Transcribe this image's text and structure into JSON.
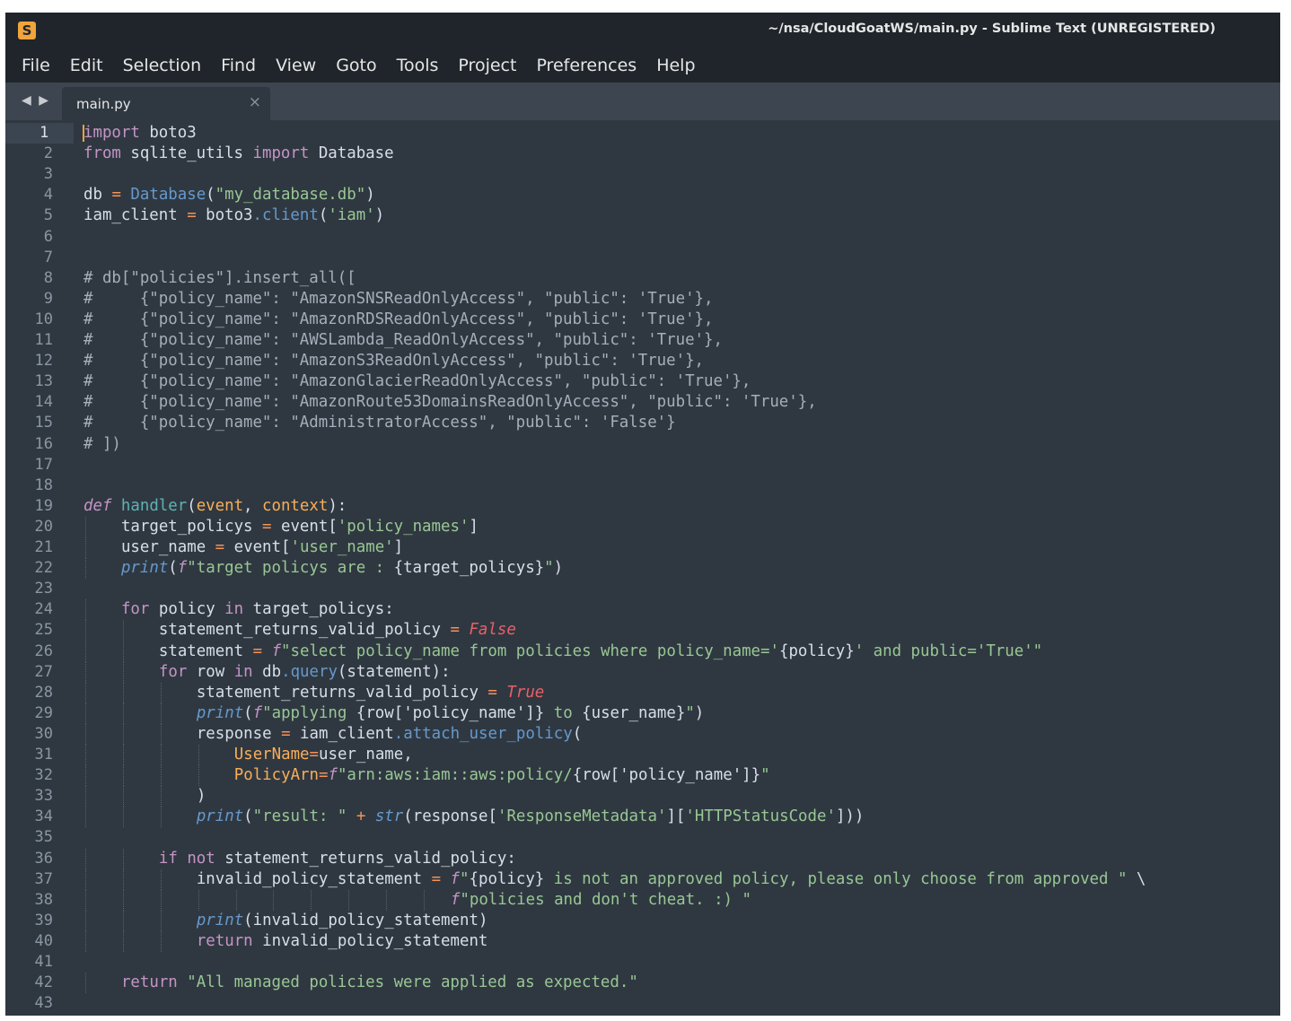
{
  "window": {
    "title": "~/nsa/CloudGoatWS/main.py - Sublime Text (UNREGISTERED)",
    "app_icon_glyph": "S"
  },
  "menubar": {
    "items": [
      "File",
      "Edit",
      "Selection",
      "Find",
      "View",
      "Goto",
      "Tools",
      "Project",
      "Preferences",
      "Help"
    ]
  },
  "tabs": [
    {
      "label": "main.py",
      "close_glyph": "×",
      "active": true
    }
  ],
  "tab_nav_glyph": "◀ ▶",
  "editor": {
    "active_line": 1,
    "line_numbers": [
      "1",
      "2",
      "3",
      "4",
      "5",
      "6",
      "7",
      "8",
      "9",
      "10",
      "11",
      "12",
      "13",
      "14",
      "15",
      "16",
      "17",
      "18",
      "19",
      "20",
      "21",
      "22",
      "23",
      "24",
      "25",
      "26",
      "27",
      "28",
      "29",
      "30",
      "31",
      "32",
      "33",
      "34",
      "35",
      "36",
      "37",
      "38",
      "39",
      "40",
      "41",
      "42",
      "43"
    ],
    "code_lines": [
      "import boto3",
      "from sqlite_utils import Database",
      "",
      "db = Database(\"my_database.db\")",
      "iam_client = boto3.client('iam')",
      "",
      "",
      "# db[\"policies\"].insert_all([",
      "#     {\"policy_name\": \"AmazonSNSReadOnlyAccess\", \"public\": 'True'},",
      "#     {\"policy_name\": \"AmazonRDSReadOnlyAccess\", \"public\": 'True'},",
      "#     {\"policy_name\": \"AWSLambda_ReadOnlyAccess\", \"public\": 'True'},",
      "#     {\"policy_name\": \"AmazonS3ReadOnlyAccess\", \"public\": 'True'},",
      "#     {\"policy_name\": \"AmazonGlacierReadOnlyAccess\", \"public\": 'True'},",
      "#     {\"policy_name\": \"AmazonRoute53DomainsReadOnlyAccess\", \"public\": 'True'},",
      "#     {\"policy_name\": \"AdministratorAccess\", \"public\": 'False'}",
      "# ])",
      "",
      "",
      "def handler(event, context):",
      "    target_policys = event['policy_names']",
      "    user_name = event['user_name']",
      "    print(f\"target policys are : {target_policys}\")",
      "",
      "    for policy in target_policys:",
      "        statement_returns_valid_policy = False",
      "        statement = f\"select policy_name from policies where policy_name='{policy}' and public='True'\"",
      "        for row in db.query(statement):",
      "            statement_returns_valid_policy = True",
      "            print(f\"applying {row['policy_name']} to {user_name}\")",
      "            response = iam_client.attach_user_policy(",
      "                UserName=user_name,",
      "                PolicyArn=f\"arn:aws:iam::aws:policy/{row['policy_name']}\"",
      "            )",
      "            print(\"result: \" + str(response['ResponseMetadata']['HTTPStatusCode']))",
      "",
      "        if not statement_returns_valid_policy:",
      "            invalid_policy_statement = f\"{policy} is not an approved policy, please only choose from approved \" \\",
      "                                       f\"policies and don't cheat. :) \"",
      "            print(invalid_policy_statement)",
      "            return invalid_policy_statement",
      "",
      "    return \"All managed policies were applied as expected.\"",
      ""
    ]
  },
  "colors": {
    "background": "#2f3841",
    "chrome": "#1f252b",
    "keyword": "#c594c5",
    "string": "#99c794",
    "function": "#6699cc",
    "operator": "#f99157",
    "comment": "#a7adba",
    "boolean": "#ec5f67",
    "caret": "#f0a43c"
  }
}
